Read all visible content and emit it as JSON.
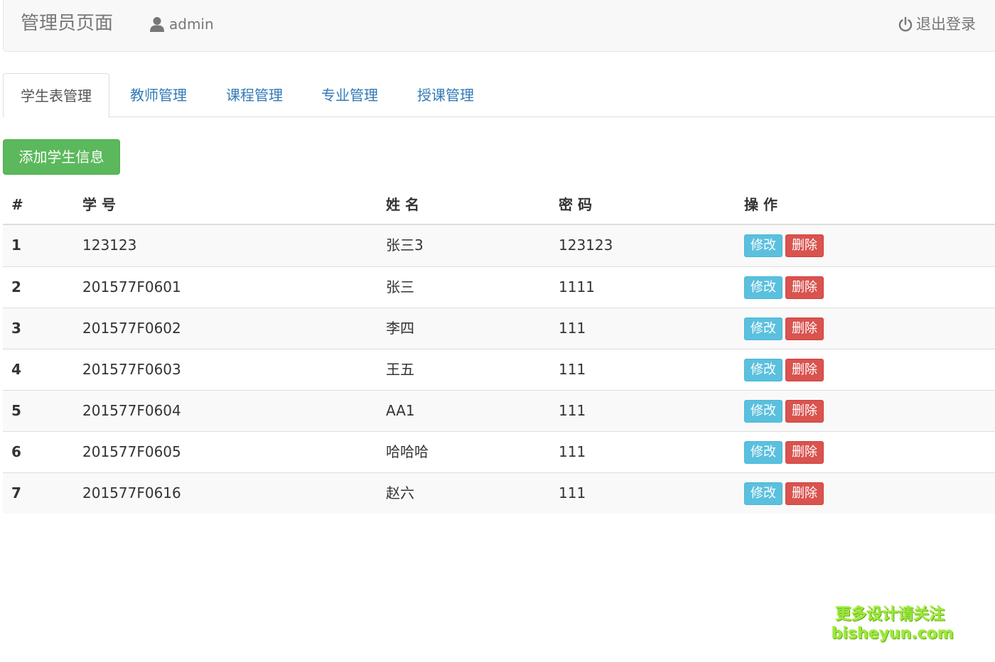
{
  "navbar": {
    "brand": "管理员页面",
    "user": "admin",
    "logout": "退出登录"
  },
  "tabs": [
    {
      "label": "学生表管理",
      "active": true
    },
    {
      "label": "教师管理",
      "active": false
    },
    {
      "label": "课程管理",
      "active": false
    },
    {
      "label": "专业管理",
      "active": false
    },
    {
      "label": "授课管理",
      "active": false
    }
  ],
  "add_button": "添加学生信息",
  "table": {
    "headers": [
      "#",
      "学 号",
      "姓 名",
      "密 码",
      "操 作"
    ],
    "rows": [
      {
        "idx": "1",
        "id": "123123",
        "name": "张三3",
        "pwd": "123123"
      },
      {
        "idx": "2",
        "id": "201577F0601",
        "name": "张三",
        "pwd": "1111"
      },
      {
        "idx": "3",
        "id": "201577F0602",
        "name": "李四",
        "pwd": "111"
      },
      {
        "idx": "4",
        "id": "201577F0603",
        "name": "王五",
        "pwd": "111"
      },
      {
        "idx": "5",
        "id": "201577F0604",
        "name": "AA1",
        "pwd": "111"
      },
      {
        "idx": "6",
        "id": "201577F0605",
        "name": "哈哈哈",
        "pwd": "111"
      },
      {
        "idx": "7",
        "id": "201577F0616",
        "name": "赵六",
        "pwd": "111"
      }
    ],
    "edit_label": "修改",
    "delete_label": "删除"
  },
  "watermark": {
    "line1": "更多设计请关注",
    "line2": "bisheyun.com"
  },
  "colors": {
    "success": "#5cb85c",
    "info": "#5bc0de",
    "danger": "#d9534f",
    "link": "#337ab7"
  }
}
